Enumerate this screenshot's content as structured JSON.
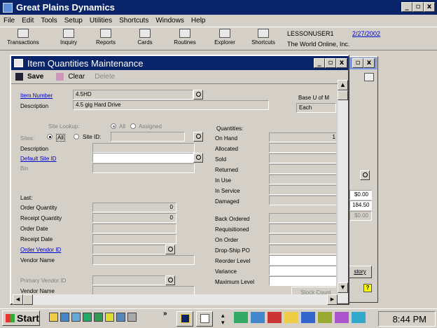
{
  "app": {
    "title": "Great Plains Dynamics"
  },
  "menu": [
    "File",
    "Edit",
    "Tools",
    "Setup",
    "Utilities",
    "Shortcuts",
    "Windows",
    "Help"
  ],
  "toolbar": {
    "items": [
      "Transactions",
      "Inquiry",
      "Reports",
      "Cards",
      "Routines",
      "Explorer",
      "Shortcuts"
    ],
    "user": "LESSONUSER1",
    "date": "2/27/2002",
    "company": "The World Online, Inc."
  },
  "window": {
    "title": "Item Quantities Maintenance",
    "buttons": {
      "save": "Save",
      "clear": "Clear",
      "delete": "Delete"
    }
  },
  "form": {
    "item_number_label": "Item Number",
    "item_number": "4.5HD",
    "description_label": "Description",
    "description": "4.5 gig Hard Drive",
    "base_uom_label": "Base U of M",
    "base_uom": "Each",
    "site_lookup_label": "Site Lookup:",
    "all": "All",
    "assigned": "Assigned",
    "sites_label": "Sites:",
    "sites_all": "All",
    "site_id_label": "Site ID:",
    "site_description_label": "Description",
    "default_site_label": "Default Site ID",
    "bin_label": "Bin",
    "last_label": "Last:",
    "order_quantity_label": "Order Quantity",
    "order_quantity": "0",
    "receipt_quantity_label": "Receipt Quantity",
    "receipt_quantity": "0",
    "order_date_label": "Order Date",
    "receipt_date_label": "Receipt Date",
    "order_vendor_label": "Order Vendor ID",
    "vendor_name_label": "Vendor Name",
    "primary_vendor_label": "Primary Vendor ID",
    "vendor_name2_label": "Vendor Name",
    "quantities_label": "Quantities:",
    "quantities": [
      "On Hand",
      "Allocated",
      "Sold",
      "Returned",
      "In Use",
      "In Service",
      "Damaged"
    ],
    "on_hand_value": "1",
    "levels": [
      "Back Ordered",
      "Requisitioned",
      "On Order",
      "Drop-Ship PO",
      "Reorder Level",
      "Variance",
      "Maximum Level"
    ],
    "stock_count": "Stock Count"
  },
  "background_window": {
    "val1": "$0.00",
    "val2": "184.50",
    "val3": "$0.00",
    "btn": "story"
  },
  "taskbar": {
    "start": "Start",
    "clock": "8:44 PM"
  }
}
